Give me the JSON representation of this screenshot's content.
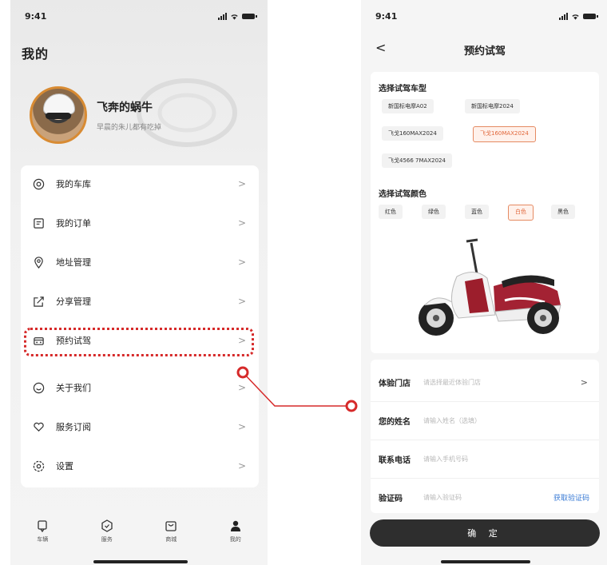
{
  "left": {
    "status": {
      "time": "9:41"
    },
    "title": "我的",
    "user": {
      "name": "飞奔的蜗牛",
      "subtitle": "早晨的朱儿都有吃掉"
    },
    "menu": [
      {
        "label": "我的车库",
        "icon": "bike-icon"
      },
      {
        "label": "我的订单",
        "icon": "order-icon"
      },
      {
        "label": "地址管理",
        "icon": "location-pin-icon"
      },
      {
        "label": "分享管理",
        "icon": "share-icon"
      },
      {
        "label": "预约试驾",
        "icon": "test-drive-icon"
      },
      {
        "label": "关于我们",
        "icon": "smile-icon"
      },
      {
        "label": "服务订阅",
        "icon": "heart-icon"
      },
      {
        "label": "设置",
        "icon": "settings-icon"
      }
    ],
    "chevron": ">",
    "tabs": [
      {
        "label": "车辆",
        "icon": "car-tab-icon"
      },
      {
        "label": "服务",
        "icon": "service-tab-icon"
      },
      {
        "label": "商城",
        "icon": "shop-tab-icon"
      },
      {
        "label": "我的",
        "icon": "profile-tab-icon",
        "active": true
      }
    ]
  },
  "right": {
    "status": {
      "time": "9:41"
    },
    "nav": {
      "back": "<",
      "title": "预约试驾"
    },
    "model_section": {
      "title": "选择试驾车型",
      "options": [
        "新国标电摩A02",
        "新国标电摩2024",
        "飞戈160MAX2024",
        "飞戈160MAX2024",
        "飞戈4566 7MAX2024"
      ],
      "selected_index": 3
    },
    "color_section": {
      "title": "选择试驾颜色",
      "options": [
        "红色",
        "绿色",
        "蓝色",
        "白色",
        "黑色"
      ],
      "selected_index": 3
    },
    "form": {
      "store": {
        "label": "体验门店",
        "placeholder": "请选择最近体验门店",
        "arrow": ">"
      },
      "name": {
        "label": "您的姓名",
        "placeholder": "请输入姓名（选填）"
      },
      "phone": {
        "label": "联系电话",
        "placeholder": "请输入手机号码"
      },
      "code": {
        "label": "验证码",
        "placeholder": "请输入验证码",
        "action": "获取验证码"
      }
    },
    "submit": "确 定"
  },
  "colors": {
    "accent_red": "#d62a2a",
    "selected_orange": "#e1683c",
    "link_blue": "#3a7bd5",
    "button_dark": "#2e2e2e"
  }
}
